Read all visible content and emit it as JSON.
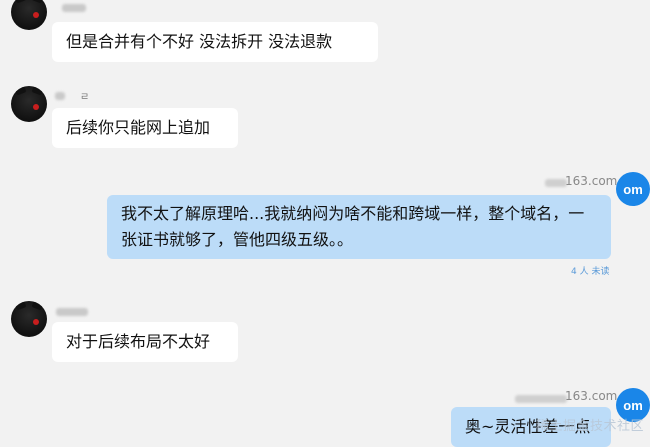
{
  "messages": [
    {
      "sender": "other",
      "text": "但是合并有个不好 没法拆开  没法退款"
    },
    {
      "sender": "other",
      "name_mark": "ㄹ",
      "text": "后续你只能网上追加"
    },
    {
      "sender": "me",
      "name_suffix": "163.com",
      "text": "我不太了解原理哈...我就纳闷为啥不能和跨域一样，整个域名，一张证书就够了，管他四级五级。。",
      "status": "4 人 未读"
    },
    {
      "sender": "other",
      "text": "对于后续布局不太好"
    },
    {
      "sender": "me",
      "name_suffix": "163.com",
      "text": "奥~灵活性差一点"
    }
  ],
  "me_avatar_label": "om",
  "watermark": "稀土掘金技术社区",
  "colors": {
    "background": "#f2f2f2",
    "incoming": "#ffffff",
    "outgoing": "#bcdcf8",
    "accent": "#1a86e8"
  }
}
